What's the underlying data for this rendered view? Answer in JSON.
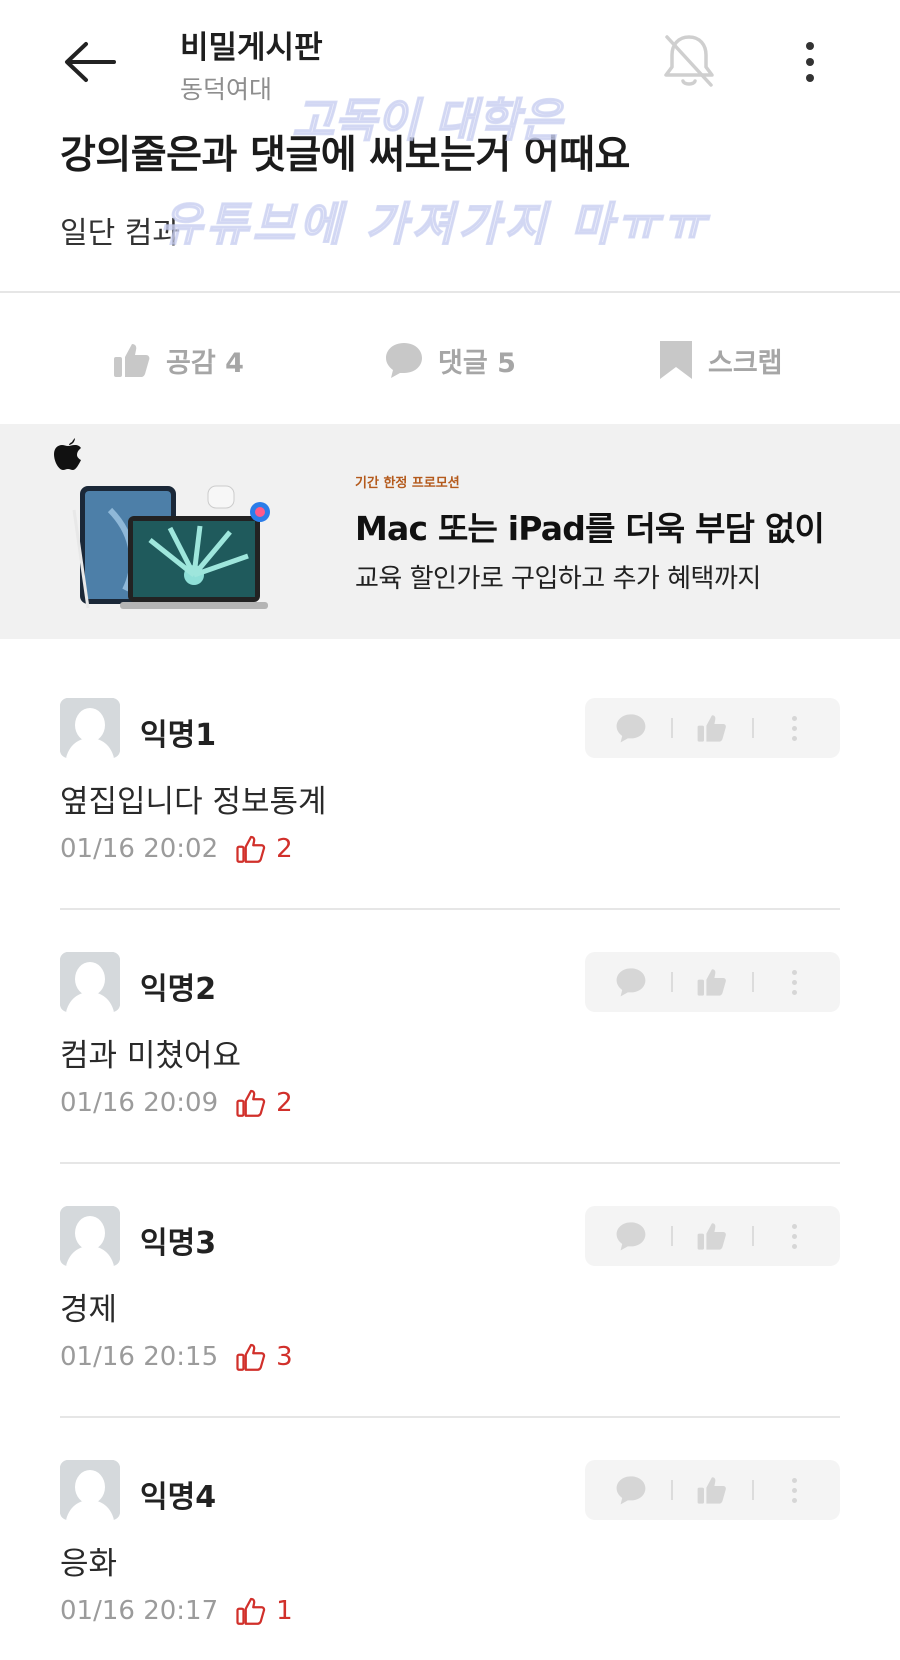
{
  "header": {
    "board_title": "비밀게시판",
    "board_subtitle": "동덕여대"
  },
  "post": {
    "title": "강의줄은과 댓글에 써보는거 어때요",
    "body": "일단 컴과",
    "watermark_line1": "고독이 대학은",
    "watermark_line2": "유튜브에 가져가지 마ㅠㅠ"
  },
  "actions": {
    "like_label": "공감 4",
    "comment_label": "댓글 5",
    "scrap_label": "스크랩"
  },
  "ad": {
    "tag": "기간 한정 프로모션",
    "title": "Mac 또는 iPad를 더욱 부담 없이",
    "subtitle": "교육 할인가로 구입하고 추가 혜택까지"
  },
  "comments": [
    {
      "name": "익명1",
      "text": "옆집입니다 정보통계",
      "time": "01/16 20:02",
      "likes": "2"
    },
    {
      "name": "익명2",
      "text": "컴과 미쳤어요",
      "time": "01/16 20:09",
      "likes": "2"
    },
    {
      "name": "익명3",
      "text": "경제",
      "time": "01/16 20:15",
      "likes": "3"
    },
    {
      "name": "익명4",
      "text": "응화",
      "time": "01/16 20:17",
      "likes": "1"
    }
  ],
  "colors": {
    "accent_like": "#d1302b",
    "muted_icon": "#c8c8c8",
    "ad_background": "#f1f1f1"
  }
}
